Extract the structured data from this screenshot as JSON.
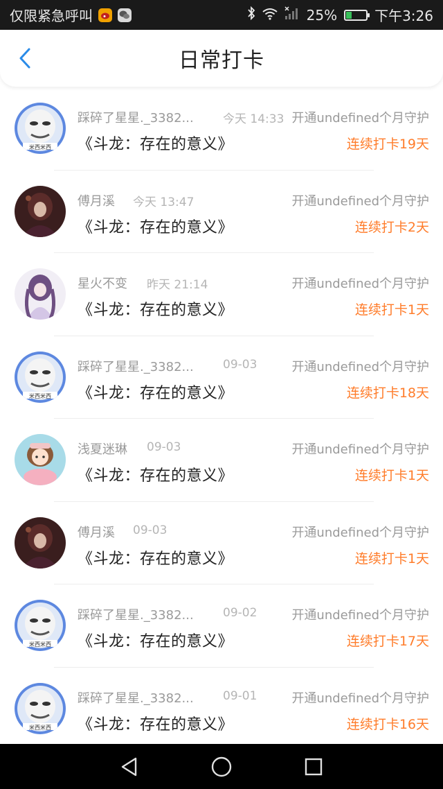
{
  "status_bar": {
    "left_text": "仅限紧急呼叫",
    "battery": "25%",
    "time": "下午3:26",
    "battery_level": 0.25,
    "battery_color": "#39c05a"
  },
  "header": {
    "title": "日常打卡"
  },
  "items": [
    {
      "name": "踩碎了星星._3382...",
      "time": "今天 14:33",
      "guard": "开通undefined个月守护",
      "book": "《斗龙：存在的意义》",
      "streak": "连续打卡19天",
      "avatar": "meme-face"
    },
    {
      "name": "傅月溪",
      "time": "今天 13:47",
      "guard": "开通undefined个月守护",
      "book": "《斗龙：存在的意义》",
      "streak": "连续打卡2天",
      "avatar": "dark-anime-girl"
    },
    {
      "name": "星火不变",
      "time": "昨天 21:14",
      "guard": "开通undefined个月守护",
      "book": "《斗龙：存在的意义》",
      "streak": "连续打卡1天",
      "avatar": "purple-anime-girl"
    },
    {
      "name": "踩碎了星星._3382...",
      "time": "09-03",
      "guard": "开通undefined个月守护",
      "book": "《斗龙：存在的意义》",
      "streak": "连续打卡18天",
      "avatar": "meme-face"
    },
    {
      "name": "浅夏迷琳",
      "time": "09-03",
      "guard": "开通undefined个月守护",
      "book": "《斗龙：存在的意义》",
      "streak": "连续打卡1天",
      "avatar": "cartoon-girl"
    },
    {
      "name": "傅月溪",
      "time": "09-03",
      "guard": "开通undefined个月守护",
      "book": "《斗龙：存在的意义》",
      "streak": "连续打卡1天",
      "avatar": "dark-anime-girl"
    },
    {
      "name": "踩碎了星星._3382...",
      "time": "09-02",
      "guard": "开通undefined个月守护",
      "book": "《斗龙：存在的意义》",
      "streak": "连续打卡17天",
      "avatar": "meme-face"
    },
    {
      "name": "踩碎了星星._3382...",
      "time": "09-01",
      "guard": "开通undefined个月守护",
      "book": "《斗龙：存在的意义》",
      "streak": "连续打卡16天",
      "avatar": "meme-face"
    }
  ],
  "colors": {
    "accent_back": "#2a8be8",
    "streak": "#ff7c2a"
  }
}
